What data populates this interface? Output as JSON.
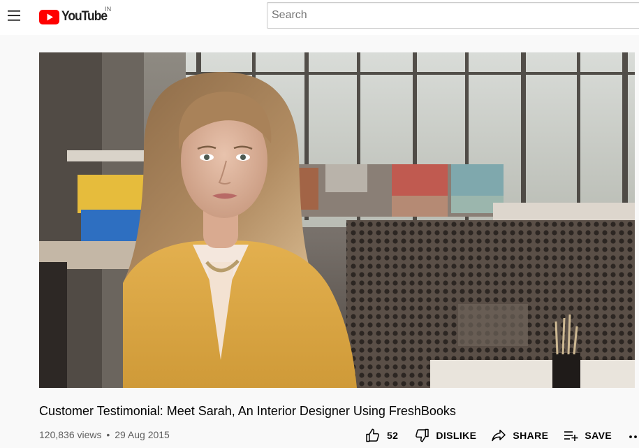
{
  "masthead": {
    "logo_text": "YouTube",
    "country_code": "IN",
    "search_placeholder": "Search",
    "brand_red": "#ff0000"
  },
  "video": {
    "title": "Customer Testimonial: Meet Sarah, An Interior Designer Using FreshBooks",
    "views": "120,836 views",
    "separator": "•",
    "date": "29 Aug 2015"
  },
  "actions": {
    "like_count": "52",
    "dislike_label": "DISLIKE",
    "share_label": "SHARE",
    "save_label": "SAVE"
  },
  "icons": {
    "menu": "hamburger-menu-icon",
    "like": "thumb-up-icon",
    "dislike": "thumb-down-icon",
    "share": "share-arrow-icon",
    "save": "playlist-add-icon",
    "more": "more-horizontal-icon"
  }
}
